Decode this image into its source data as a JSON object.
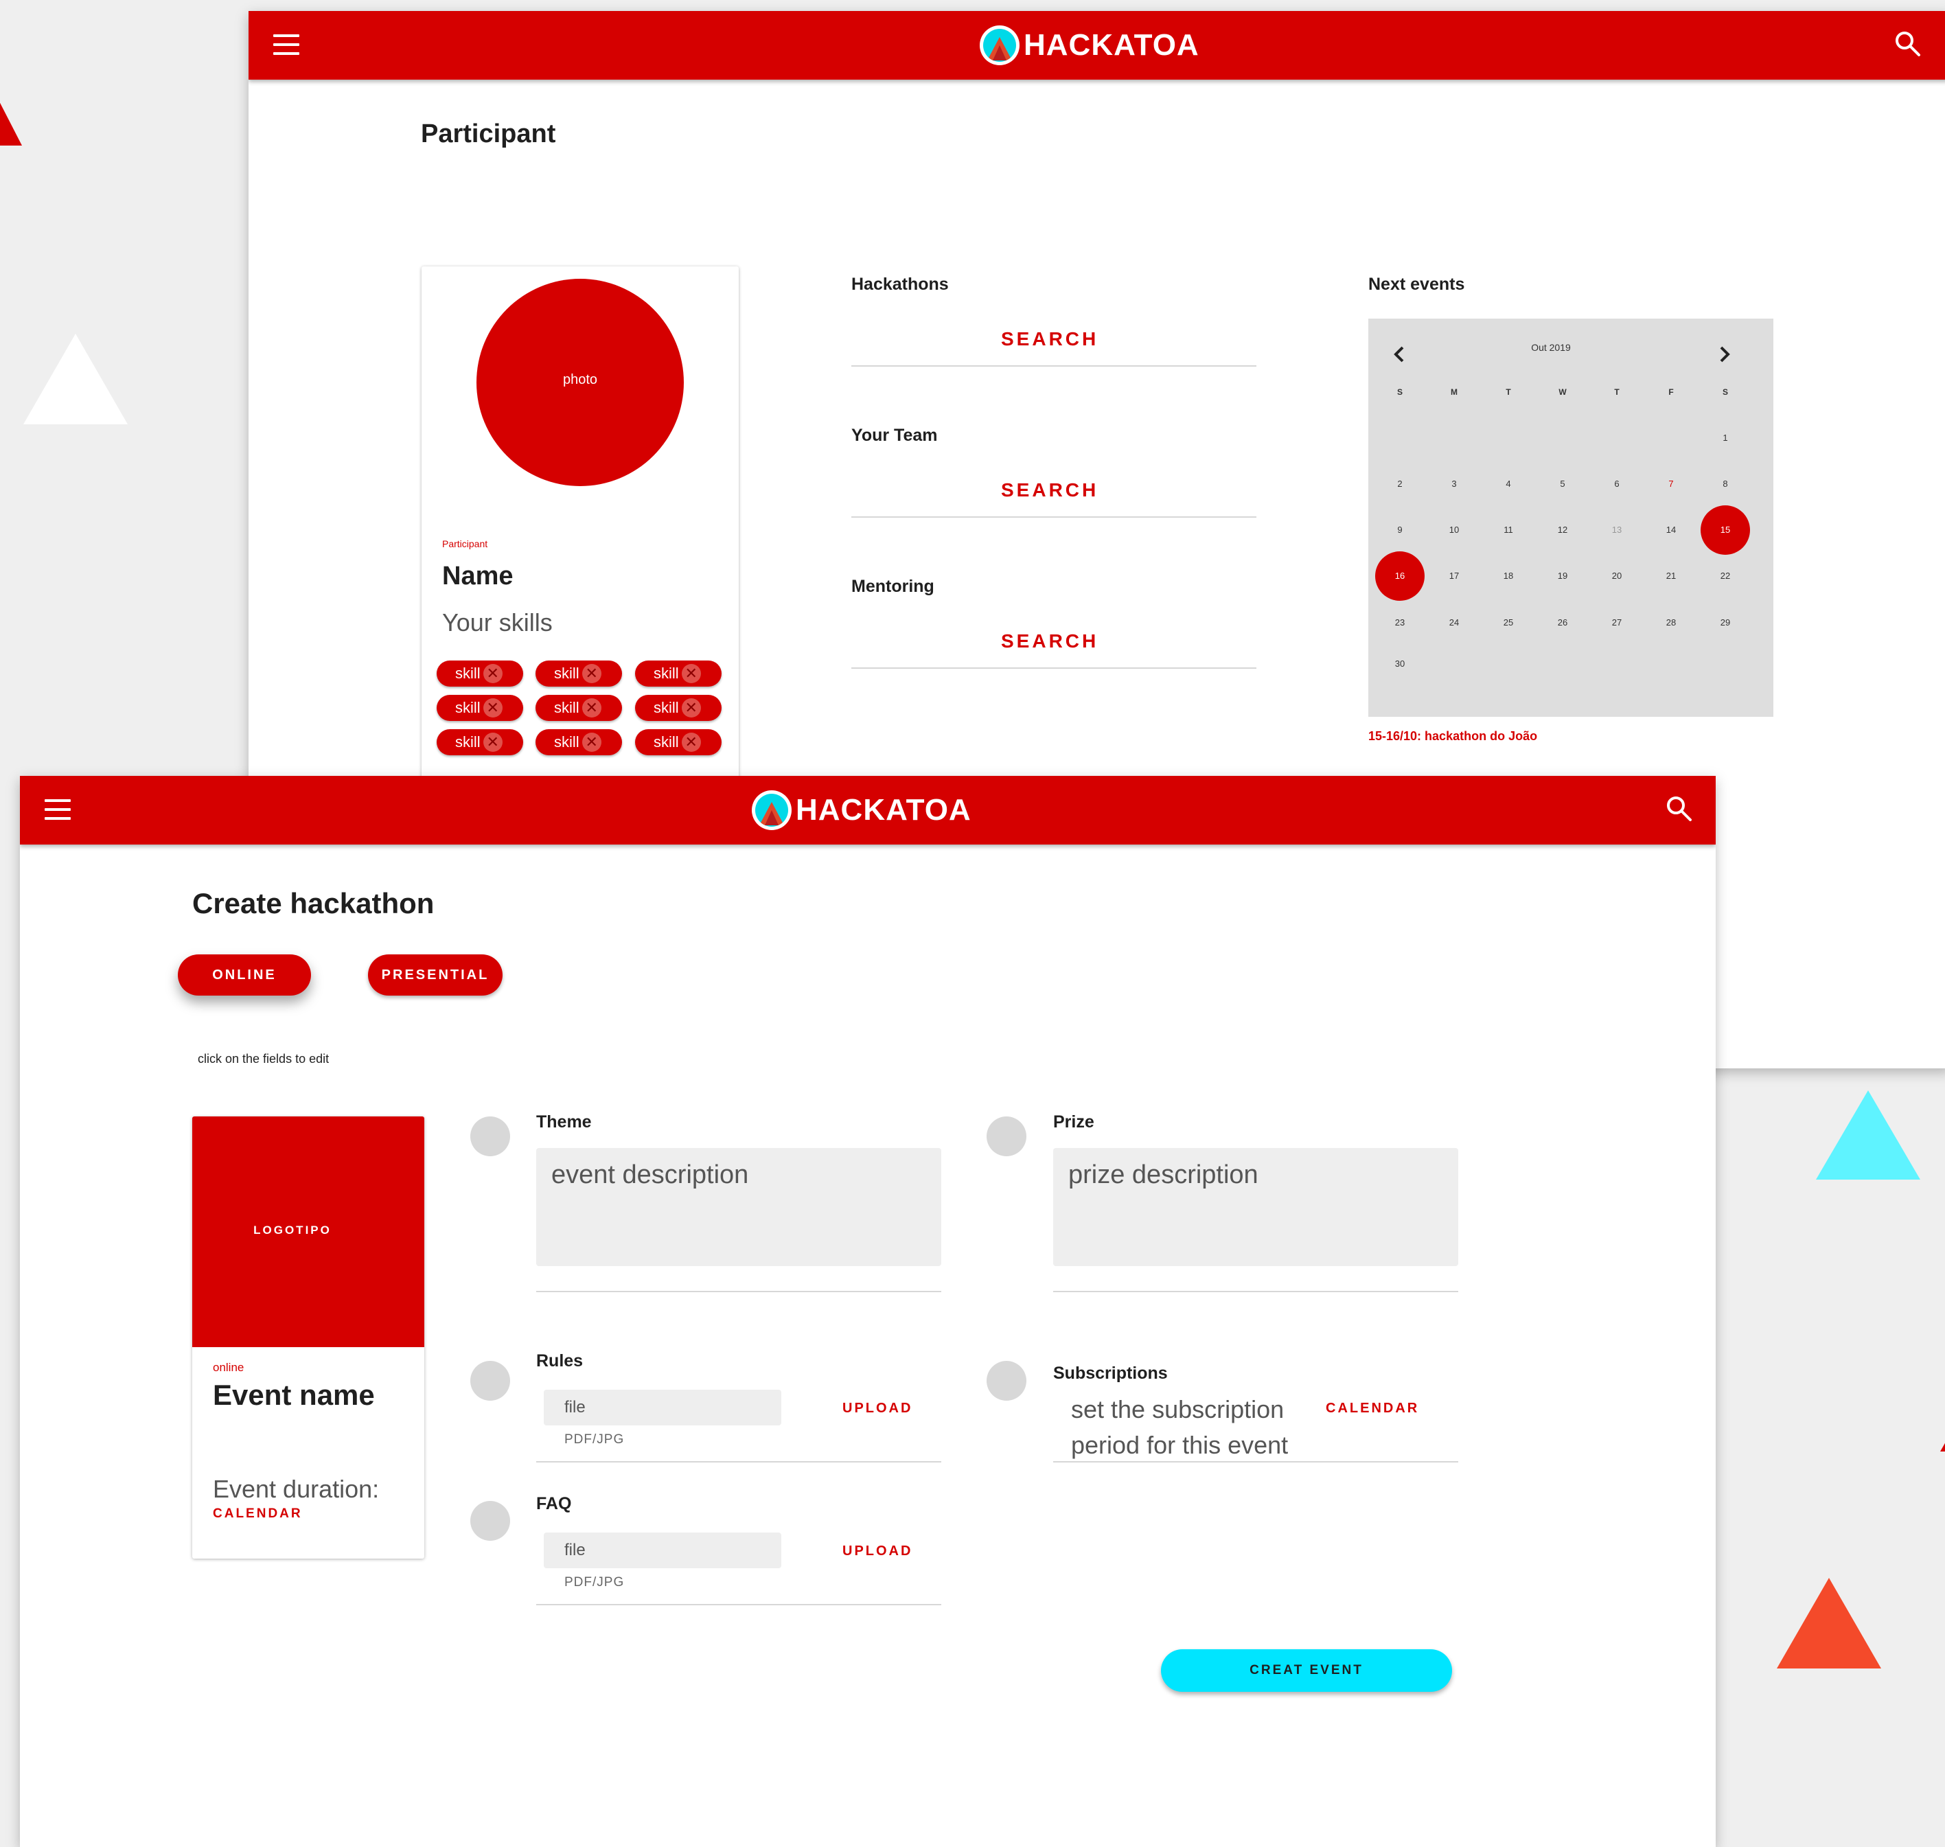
{
  "colors": {
    "brand_red": "#d50000",
    "accent_cyan": "#00e5ff",
    "background": "#efefef",
    "orange": "#f44a2a"
  },
  "participant_window": {
    "app_title": "HACKATOA",
    "page_title": "Participant",
    "profile": {
      "photo_label": "photo",
      "role": "Participant",
      "name": "Name",
      "skills_heading": "Your skills",
      "skills": [
        "skill",
        "skill",
        "skill",
        "skill",
        "skill",
        "skill",
        "skill",
        "skill",
        "skill"
      ]
    },
    "sections": [
      {
        "title": "Hackathons",
        "action": "SEARCH"
      },
      {
        "title": "Your Team",
        "action": "SEARCH"
      },
      {
        "title": "Mentoring",
        "action": "SEARCH"
      }
    ],
    "next_events": {
      "title": "Next events",
      "month": "Out 2019",
      "weekdays": [
        "S",
        "M",
        "T",
        "W",
        "T",
        "F",
        "S"
      ],
      "weeks": [
        [
          "",
          "",
          "",
          "",
          "",
          "",
          "1"
        ],
        [
          "2",
          "3",
          "4",
          "5",
          "6",
          "7",
          "8"
        ],
        [
          "9",
          "10",
          "11",
          "12",
          "13",
          "14",
          "15"
        ],
        [
          "16",
          "17",
          "18",
          "19",
          "20",
          "21",
          "22"
        ],
        [
          "23",
          "24",
          "25",
          "26",
          "27",
          "28",
          "29"
        ],
        [
          "30",
          "",
          "",
          "",
          "",
          "",
          ""
        ]
      ],
      "highlighted_days": [
        "15",
        "16"
      ],
      "red_days": [
        "7"
      ],
      "muted_days": [
        "13"
      ],
      "event_note": "15-16/10: hackathon do João"
    }
  },
  "create_window": {
    "app_title": "HACKATOA",
    "page_title": "Create hackathon",
    "modes": [
      "ONLINE",
      "PRESENTIAL"
    ],
    "hint": "click on the fields to edit",
    "event_card": {
      "logo_label": "LOGOTIPO",
      "mode": "online",
      "name": "Event name",
      "duration_label": "Event duration:",
      "calendar_action": "CALENDAR"
    },
    "theme": {
      "label": "Theme",
      "placeholder": "event description"
    },
    "prize": {
      "label": "Prize",
      "placeholder": "prize description"
    },
    "rules": {
      "label": "Rules",
      "file_placeholder": "file",
      "formats": "PDF/JPG",
      "action": "UPLOAD"
    },
    "faq": {
      "label": "FAQ",
      "file_placeholder": "file",
      "formats": "PDF/JPG",
      "action": "UPLOAD"
    },
    "subscriptions": {
      "label": "Subscriptions",
      "line1": "set the subscription",
      "line2": "period for this event",
      "action": "CALENDAR"
    },
    "submit_label": "CREAT EVENT"
  }
}
